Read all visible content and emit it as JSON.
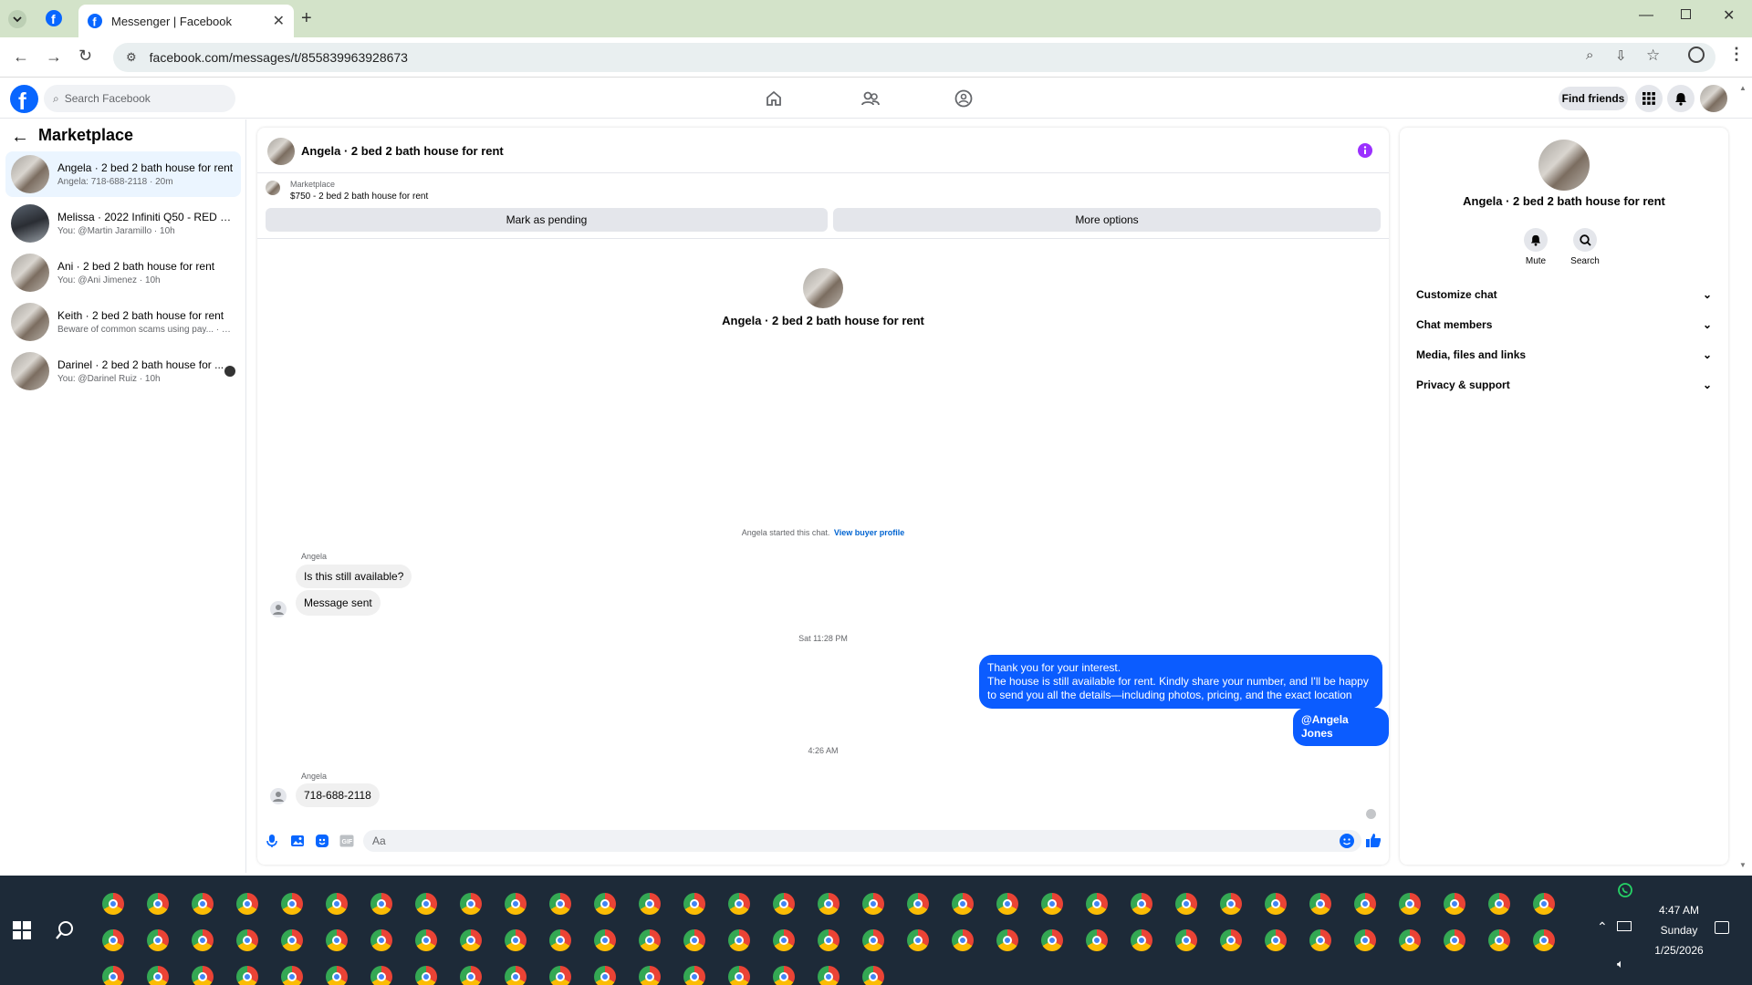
{
  "browser": {
    "tab_title": "Messenger | Facebook",
    "url": "facebook.com/messages/t/855839963928673"
  },
  "header": {
    "search_placeholder": "Search Facebook",
    "find_friends": "Find friends"
  },
  "sidebar": {
    "title": "Marketplace",
    "conversations": [
      {
        "name": "Angela · 2 bed 2 bath house for rent",
        "sub": "Angela: 718-688-2118 · 20m"
      },
      {
        "name": "Melissa · 2022 Infiniti Q50 - RED S...",
        "sub": "You: @Martin Jaramillo · 10h"
      },
      {
        "name": "Ani · 2 bed 2 bath house for rent",
        "sub": "You: @Ani Jimenez · 10h"
      },
      {
        "name": "Keith · 2 bed 2 bath house for rent",
        "sub": "Beware of common scams using pay... · 10h"
      },
      {
        "name": "Darinel · 2 bed 2 bath house for ...",
        "sub": "You: @Darinel Ruiz · 10h"
      }
    ]
  },
  "chat": {
    "title": "Angela · 2 bed 2 bath house for rent",
    "listing_source": "Marketplace",
    "listing_info": "$750 - 2 bed 2 bath house for rent",
    "mark_pending": "Mark as pending",
    "more_options": "More options",
    "intro_name": "Angela · 2 bed 2 bath house for rent",
    "started_text": "Angela started this chat.",
    "view_profile": "View buyer profile",
    "sender1": "Angela",
    "msg1": "Is this still available?",
    "msg2": "Message sent",
    "time1": "Sat 11:28 PM",
    "out_msg_line1": "Thank you for your interest.",
    "out_msg_line2": "The house is still available for rent. Kindly share your number, and I'll be happy to send you all the details—including photos, pricing, and the exact location",
    "mention": "@Angela Jones",
    "time2": "4:26 AM",
    "sender2": "Angela",
    "msg3": "718-688-2118",
    "composer_placeholder": "Aa"
  },
  "right_panel": {
    "name": "Angela · 2 bed 2 bath house for rent",
    "mute": "Mute",
    "search": "Search",
    "sections": [
      "Customize chat",
      "Chat members",
      "Media, files and links",
      "Privacy & support"
    ]
  },
  "taskbar": {
    "time": "4:47 AM",
    "day": "Sunday",
    "date": "1/25/2026"
  },
  "colors": {
    "fb_blue": "#0866ff",
    "out_bubble": "#0b5cff",
    "chrome_tab_bg": "#d3e3c9",
    "taskbar": "#1d2a38"
  }
}
